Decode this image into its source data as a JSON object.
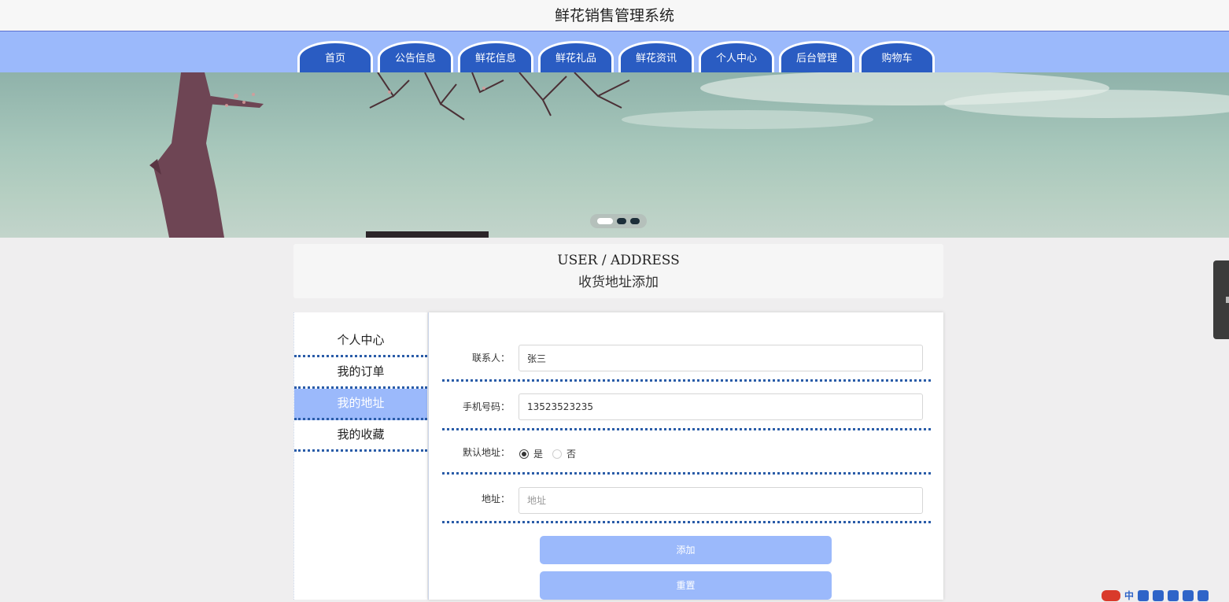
{
  "site": {
    "title": "鲜花销售管理系统"
  },
  "nav": {
    "items": [
      {
        "label": "首页"
      },
      {
        "label": "公告信息"
      },
      {
        "label": "鲜花信息"
      },
      {
        "label": "鲜花礼品"
      },
      {
        "label": "鲜花资讯"
      },
      {
        "label": "个人中心"
      },
      {
        "label": "后台管理"
      },
      {
        "label": "购物车"
      }
    ]
  },
  "banner": {
    "active_slide": 1,
    "slide_count": 3
  },
  "page": {
    "title_en": "USER / ADDRESS",
    "title_cn": "收货地址添加"
  },
  "side_menu": {
    "items": [
      {
        "label": "个人中心"
      },
      {
        "label": "我的订单"
      },
      {
        "label": "我的地址",
        "active": true
      },
      {
        "label": "我的收藏"
      }
    ]
  },
  "form": {
    "contact_label": "联系人：",
    "contact_value": "张三",
    "phone_label": "手机号码：",
    "phone_value": "13523523235",
    "default_label": "默认地址：",
    "default_yes": "是",
    "default_no": "否",
    "default_selected": "是",
    "address_label": "地址：",
    "address_placeholder": "地址",
    "address_value": "",
    "submit_label": "添加",
    "reset_label": "重置"
  },
  "tray": {
    "ime_text": "中"
  },
  "colors": {
    "nav_bg": "#9bb9fb",
    "tab_bg": "#2a5cc2",
    "accent": "#9bb9fb",
    "divider": "#2a5ca8"
  }
}
